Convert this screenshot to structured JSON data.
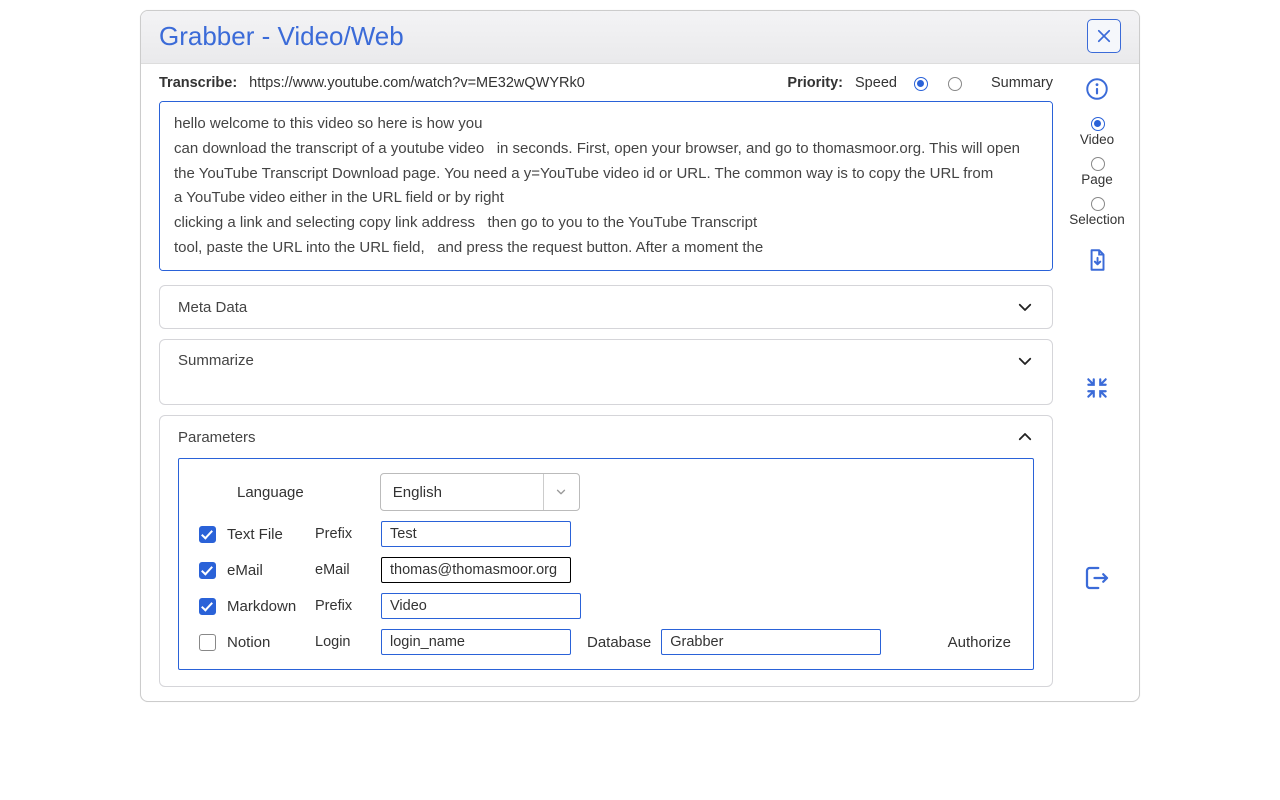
{
  "window": {
    "title": "Grabber - Video/Web"
  },
  "toprow": {
    "transcribe_label": "Transcribe:",
    "url": "https://www.youtube.com/watch?v=ME32wQWYRk0",
    "priority_label": "Priority:",
    "speed_label": "Speed",
    "summary_label": "Summary",
    "priority_selected": "speed"
  },
  "transcript": "hello welcome to this video so here is how you\ncan download the transcript of a youtube video   in seconds. First, open your browser, and go to thomasmoor.org. This will open the YouTube Transcript Download page. You need a y=YouTube video id or URL. The common way is to copy the URL from\na YouTube video either in the URL field or by right\nclicking a link and selecting copy link address   then go to you to the YouTube Transcript\ntool, paste the URL into the URL field,   and press the request button. After a moment the",
  "sections": {
    "metadata": {
      "title": "Meta Data",
      "expanded": false
    },
    "summarize": {
      "title": "Summarize",
      "expanded": false
    },
    "parameters": {
      "title": "Parameters",
      "expanded": true
    }
  },
  "params": {
    "language_label": "Language",
    "language_value": "English",
    "textfile": {
      "checked": true,
      "label": "Text File",
      "sublabel": "Prefix",
      "value": "Test"
    },
    "email": {
      "checked": true,
      "label": "eMail",
      "sublabel": "eMail",
      "value": "thomas@thomasmoor.org"
    },
    "markdown": {
      "checked": true,
      "label": "Markdown",
      "sublabel": "Prefix",
      "value": "Video"
    },
    "notion": {
      "checked": false,
      "label": "Notion",
      "login_label": "Login",
      "login_value": "login_name",
      "db_label": "Database",
      "db_value": "Grabber",
      "authorize": "Authorize"
    }
  },
  "side": {
    "modes": {
      "video": "Video",
      "page": "Page",
      "selection": "Selection",
      "selected": "video"
    }
  }
}
